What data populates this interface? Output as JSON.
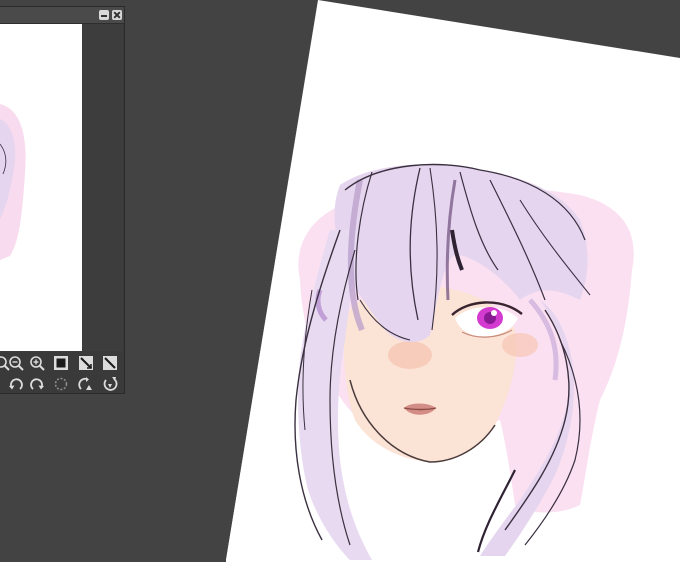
{
  "navigator": {
    "icons": [
      "zoom-out-icon",
      "zoom-in-icon",
      "fit-screen-icon",
      "flip-horizontal-icon",
      "flip-vertical-icon",
      "rotate-left-icon",
      "rotate-right-icon",
      "reset-rotation-icon",
      "rotate-canvas-icon",
      "reset-view-icon"
    ]
  },
  "colors": {
    "workspace_bg": "#434343",
    "panel_bg": "#3a3a3a",
    "paper": "#ffffff",
    "hair": "#e6d5ef",
    "hair_shadow": "#c9abd9",
    "skin": "#fbe3d6",
    "eye": "#d23ad0",
    "pink_wash": "#f9dbef"
  }
}
